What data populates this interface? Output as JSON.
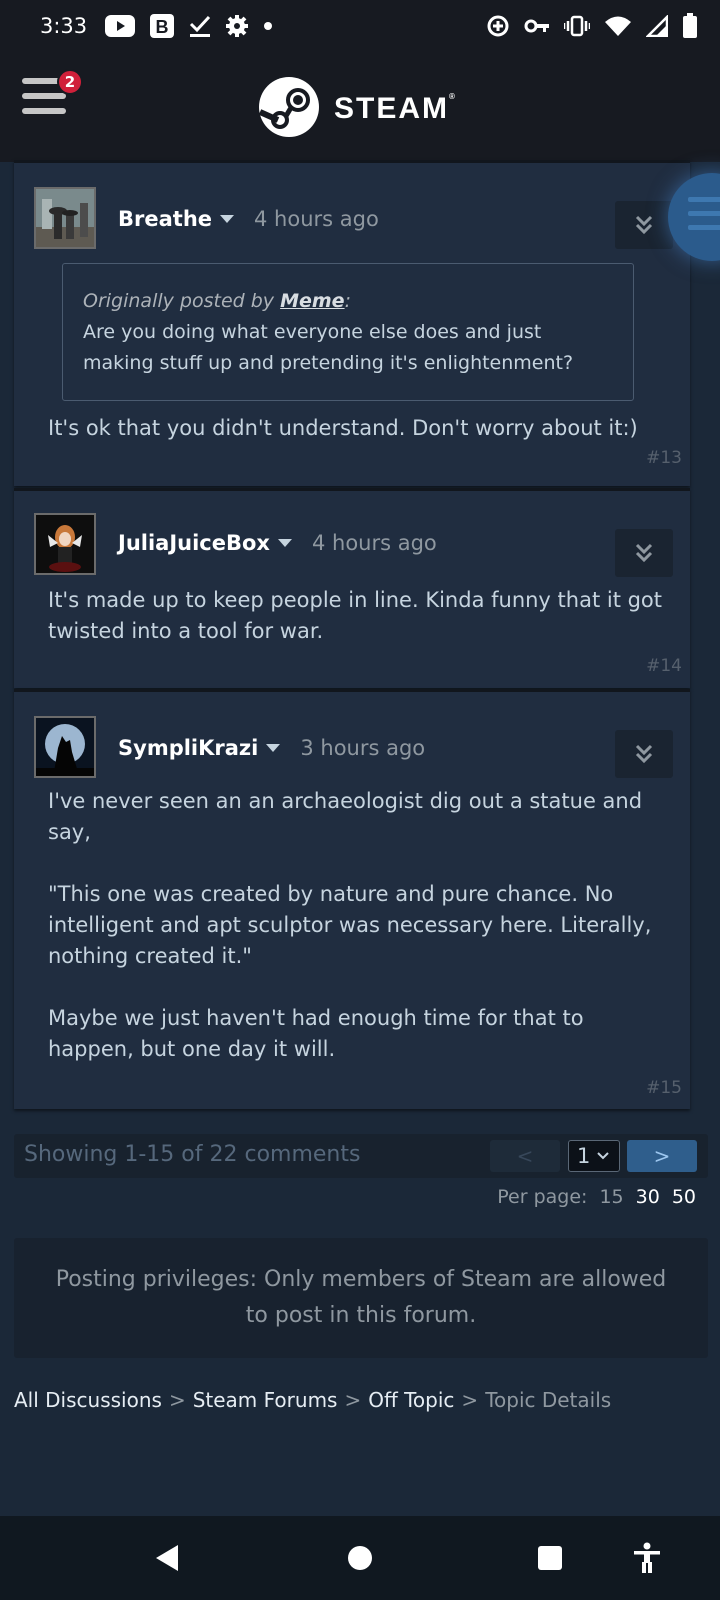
{
  "status_bar": {
    "time": "3:33",
    "left_icons": [
      "youtube-icon",
      "b-app-icon",
      "check-download-icon",
      "settings-icon",
      "dot-icon"
    ],
    "right_icons": [
      "data-saver-icon",
      "vpn-key-icon",
      "vibrate-icon",
      "wifi-icon",
      "signal-icon",
      "battery-icon"
    ]
  },
  "header": {
    "logo_text": "STEAM",
    "logo_trademark": "®",
    "menu_badge_count": "2"
  },
  "posts": [
    {
      "author": "Breathe",
      "time": "4 hours ago",
      "quote": {
        "prefix": "Originally posted by ",
        "quoted_author": "Meme",
        "suffix": ":",
        "text": "Are you doing what everyone else does and just making stuff up and pretending it's enlightenment?"
      },
      "body": "It's ok that you didn't understand. Don't worry about it:)",
      "number": "#13"
    },
    {
      "author": "JuliaJuiceBox",
      "time": "4 hours ago",
      "body": "It's made up to keep people in line. Kinda funny that it got twisted into a tool for war.",
      "number": "#14"
    },
    {
      "author": "SympliKrazi",
      "time": "3 hours ago",
      "body_paragraphs": [
        "I've never seen an an archaeologist dig out a statue and say,",
        "\"This one was created by nature and pure chance. No intelligent and apt sculptor was necessary here. Literally, nothing created it.\"",
        "Maybe we just haven't had enough time for that to happen, but one day it will."
      ],
      "number": "#15"
    }
  ],
  "pagination": {
    "showing": "Showing 1-15 of 22 comments",
    "prev_label": "<",
    "next_label": ">",
    "current_page": "1",
    "per_page_label": "Per page:",
    "per_page_options": [
      "15",
      "30",
      "50"
    ],
    "per_page_selected": "15"
  },
  "notice": "Posting privileges: Only members of Steam are allowed to post in this forum.",
  "breadcrumb": {
    "items": [
      "All Discussions",
      "Steam Forums",
      "Off Topic"
    ],
    "separator": ">",
    "current": "Topic Details"
  },
  "colors": {
    "background": "#1b2838",
    "post_background": "#202d40",
    "header_background": "#171a21",
    "accent_blue": "#2f5e8c",
    "badge_red": "#d0203a"
  },
  "nav_bar": {
    "buttons": [
      "back-icon",
      "home-icon",
      "recents-icon",
      "accessibility-icon"
    ]
  }
}
